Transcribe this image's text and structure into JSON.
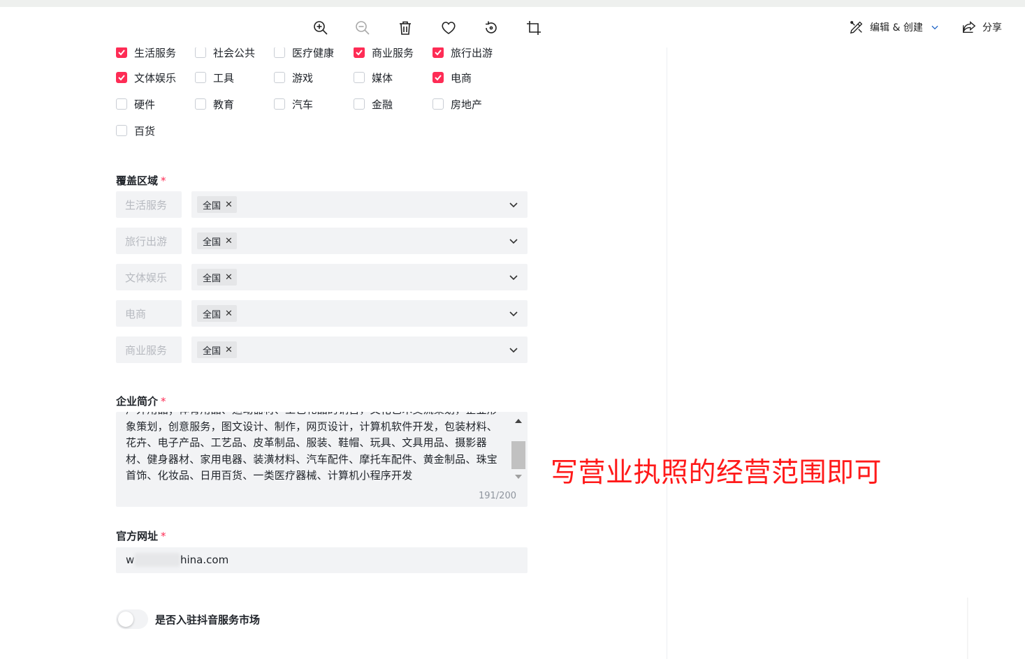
{
  "toolbar": {
    "icons": [
      "zoom-in-icon",
      "zoom-out-icon",
      "trash-icon",
      "heart-icon",
      "rotate-icon",
      "crop-icon"
    ],
    "edit_label": "编辑 & 创建",
    "share_label": "分享"
  },
  "industries": {
    "partial_row": [
      {
        "label": "生活服务",
        "checked": true
      },
      {
        "label": "社会公共",
        "checked": false
      },
      {
        "label": "医疗健康",
        "checked": false
      },
      {
        "label": "商业服务",
        "checked": true
      },
      {
        "label": "旅行出游",
        "checked": true
      }
    ],
    "row2": [
      {
        "label": "文体娱乐",
        "checked": true
      },
      {
        "label": "工具",
        "checked": false
      },
      {
        "label": "游戏",
        "checked": false
      },
      {
        "label": "媒体",
        "checked": false
      },
      {
        "label": "电商",
        "checked": true
      }
    ],
    "row3": [
      {
        "label": "硬件",
        "checked": false
      },
      {
        "label": "教育",
        "checked": false
      },
      {
        "label": "汽车",
        "checked": false
      },
      {
        "label": "金融",
        "checked": false
      },
      {
        "label": "房地产",
        "checked": false
      }
    ],
    "row4": [
      {
        "label": "百货",
        "checked": false
      }
    ]
  },
  "coverage": {
    "label": "覆盖区域",
    "required_mark": "*",
    "rows": [
      {
        "industry": "生活服务",
        "tag": "全国"
      },
      {
        "industry": "旅行出游",
        "tag": "全国"
      },
      {
        "industry": "文体娱乐",
        "tag": "全国"
      },
      {
        "industry": "电商",
        "tag": "全国"
      },
      {
        "industry": "商业服务",
        "tag": "全国"
      }
    ],
    "remove_glyph": "✕"
  },
  "intro": {
    "label": "企业简介",
    "required_mark": "*",
    "text": "户外用品；体育用品、运动器材、工艺礼品的销售，文化艺术交流策划，企业形象策划，创意服务，图文设计、制作，网页设计，计算机软件开发，包装材料、花卉、电子产品、工艺品、皮革制品、服装、鞋帽、玩具、文具用品、摄影器材、健身器材、家用电器、装潢材料、汽车配件、摩托车配件、黄金制品、珠宝首饰、化妆品、日用百货、一类医疗器械、计算机小程序开发",
    "counter": "191/200"
  },
  "website": {
    "label": "官方网址",
    "required_mark": "*",
    "value_start": "w",
    "value_end": "hina.com"
  },
  "market_toggle": {
    "label": "是否入驻抖音服务市场",
    "on": false
  },
  "annotation": {
    "text": "写营业执照的经营范围即可",
    "color": "#ff1a1a"
  },
  "colors": {
    "accent": "#fe2c55",
    "field_bg": "#f2f3f5"
  }
}
